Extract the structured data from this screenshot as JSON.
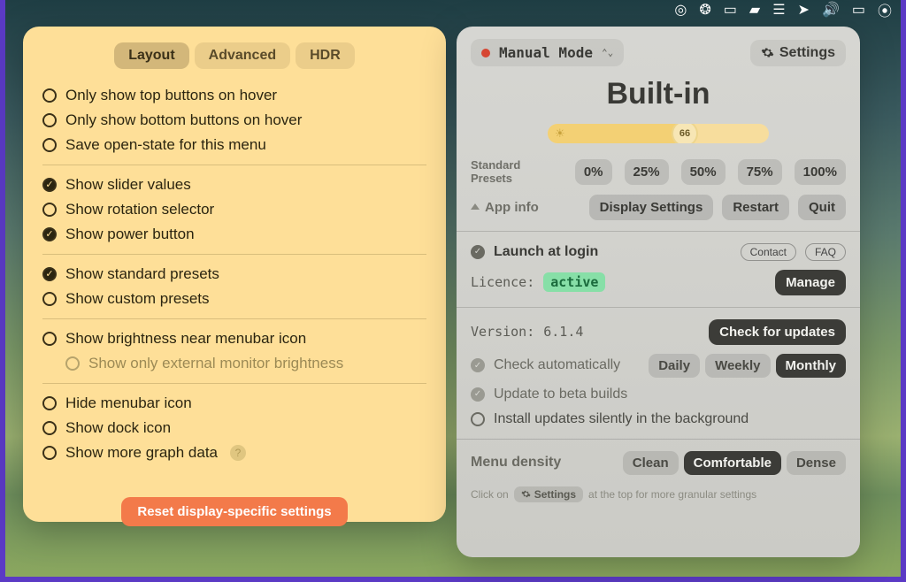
{
  "menubar_icons": [
    "target",
    "pizza",
    "display",
    "cloud",
    "drives",
    "location",
    "volume",
    "battery",
    "wifi"
  ],
  "left": {
    "tabs": [
      "Layout",
      "Advanced",
      "HDR"
    ],
    "active_tab": 0,
    "groups": [
      [
        {
          "checked": false,
          "label": "Only show top buttons on hover"
        },
        {
          "checked": false,
          "label": "Only show bottom buttons on hover"
        },
        {
          "checked": false,
          "label": "Save open-state for this menu"
        }
      ],
      [
        {
          "checked": true,
          "label": "Show slider values"
        },
        {
          "checked": false,
          "label": "Show rotation selector"
        },
        {
          "checked": true,
          "label": "Show power button"
        }
      ],
      [
        {
          "checked": true,
          "label": "Show standard presets"
        },
        {
          "checked": false,
          "label": "Show custom presets"
        }
      ],
      [
        {
          "checked": false,
          "label": "Show brightness near menubar icon"
        },
        {
          "checked": false,
          "label": "Show only external monitor brightness",
          "sub": true
        }
      ],
      [
        {
          "checked": false,
          "label": "Hide menubar icon"
        },
        {
          "checked": false,
          "label": "Show dock icon"
        },
        {
          "checked": false,
          "label": "Show more graph data",
          "help": true
        }
      ]
    ],
    "reset": "Reset display-specific settings"
  },
  "right": {
    "mode": "Manual Mode",
    "settings_label": "Settings",
    "display_name": "Built-in",
    "brightness": 66,
    "presets_label_1": "Standard",
    "presets_label_2": "Presets",
    "presets": [
      "0%",
      "25%",
      "50%",
      "75%",
      "100%"
    ],
    "app_info": "App info",
    "display_settings": "Display Settings",
    "restart": "Restart",
    "quit": "Quit",
    "launch": "Launch at login",
    "contact": "Contact",
    "faq": "FAQ",
    "licence_label": "Licence:",
    "licence_state": "active",
    "manage": "Manage",
    "version_label": "Version:",
    "version": "6.1.4",
    "check_updates": "Check for updates",
    "check_auto": "Check automatically",
    "freq": [
      "Daily",
      "Weekly",
      "Monthly"
    ],
    "freq_active": 2,
    "beta": "Update to beta builds",
    "silent": "Install updates silently in the background",
    "density_label": "Menu density",
    "density": [
      "Clean",
      "Comfortable",
      "Dense"
    ],
    "density_active": 1,
    "hint_pre": "Click on",
    "hint_chip": "Settings",
    "hint_post": "at the top for more granular settings"
  }
}
